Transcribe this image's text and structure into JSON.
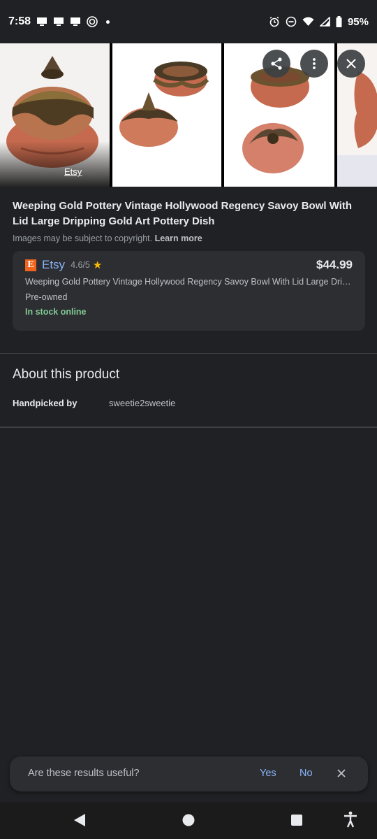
{
  "status_bar": {
    "time": "7:58",
    "battery": "95%",
    "icons": [
      "monitor-icon",
      "monitor-icon",
      "monitor-icon",
      "currency-circle-icon",
      "dot-icon",
      "alarm-icon",
      "do-not-disturb-icon",
      "wifi-icon",
      "signal-icon",
      "battery-icon"
    ]
  },
  "carousel": {
    "first_source_label": "Etsy",
    "actions": [
      "share-icon",
      "more-vert-icon",
      "close-icon"
    ]
  },
  "product": {
    "title": "Weeping Gold Pottery Vintage Hollywood Regency Savoy Bowl With Lid Large Dripping Gold Art Pottery Dish",
    "copyright_note": "Images may be subject to copyright.",
    "learn_more": "Learn more"
  },
  "merchant": {
    "logo_letter": "E",
    "name": "Etsy",
    "rating": "4.6/5",
    "star": "★",
    "price": "$44.99",
    "listing_title": "Weeping Gold Pottery Vintage Hollywood Regency Savoy Bowl With Lid Large Dripping Gold Art Pottery Dish",
    "condition": "Pre-owned",
    "availability": "In stock online",
    "colors": {
      "availability": "#81c995",
      "link": "#8ab4f8",
      "logo": "#f1641e"
    }
  },
  "about": {
    "heading": "About this product",
    "handpicked_label": "Handpicked by",
    "handpicked_value": "sweetie2sweetie"
  },
  "feedback": {
    "question": "Are these results useful?",
    "yes": "Yes",
    "no": "No"
  },
  "nav": {
    "icons": [
      "back-icon",
      "home-icon",
      "recents-icon",
      "accessibility-icon"
    ]
  }
}
